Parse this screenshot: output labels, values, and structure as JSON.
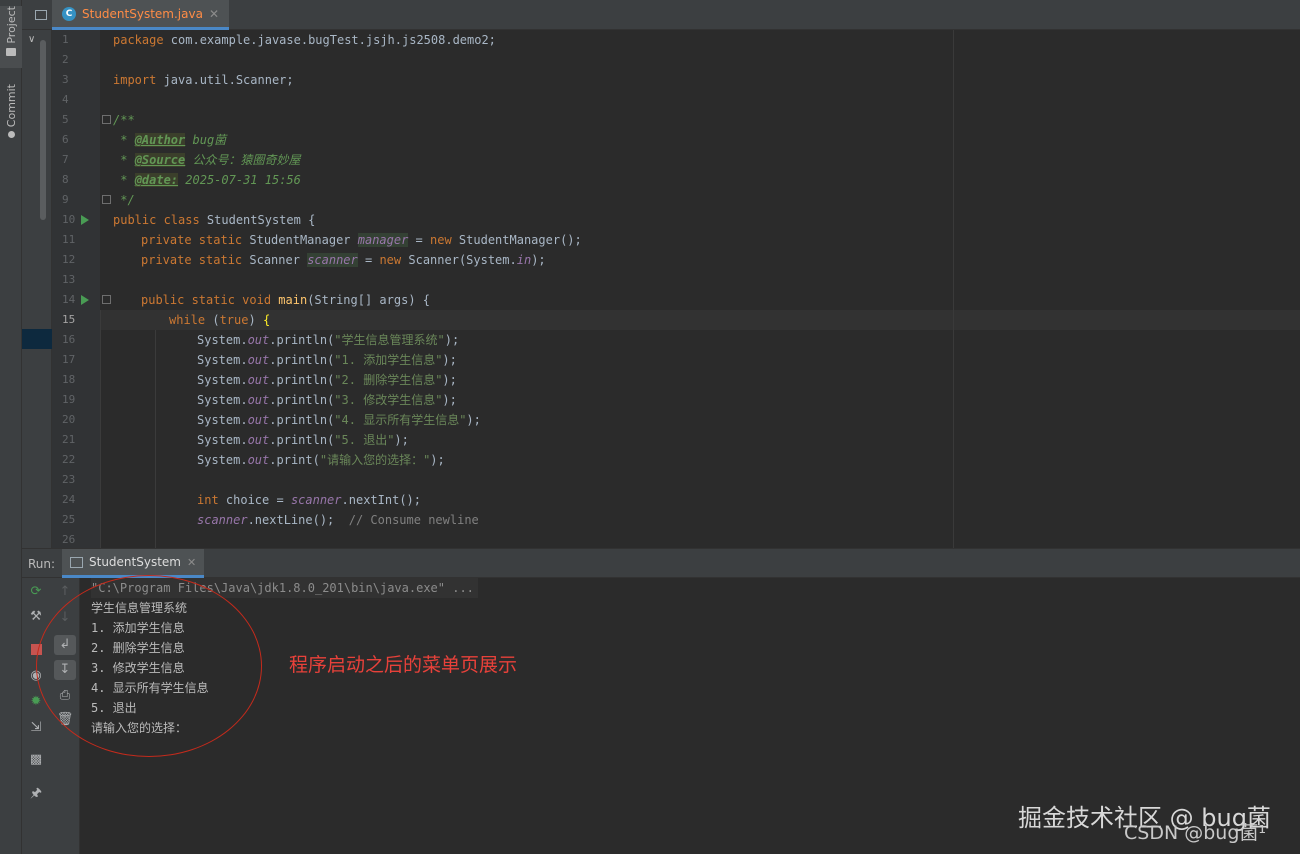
{
  "sidebar": {
    "project_label": "Project",
    "commit_label": "Commit"
  },
  "editor": {
    "tab_label": "StudentSystem.java",
    "tab_icon": "C",
    "current_line": 15,
    "lines": [
      {
        "n": "1"
      },
      {
        "n": "2"
      },
      {
        "n": "3"
      },
      {
        "n": "4"
      },
      {
        "n": "5"
      },
      {
        "n": "6"
      },
      {
        "n": "7"
      },
      {
        "n": "8"
      },
      {
        "n": "9"
      },
      {
        "n": "10"
      },
      {
        "n": "11"
      },
      {
        "n": "12"
      },
      {
        "n": "13"
      },
      {
        "n": "14"
      },
      {
        "n": "15"
      },
      {
        "n": "16"
      },
      {
        "n": "17"
      },
      {
        "n": "18"
      },
      {
        "n": "19"
      },
      {
        "n": "20"
      },
      {
        "n": "21"
      },
      {
        "n": "22"
      },
      {
        "n": "23"
      },
      {
        "n": "24"
      },
      {
        "n": "25"
      },
      {
        "n": "26"
      }
    ],
    "code": {
      "l1_kw": "package",
      "l1_rest": " com.example.javase.bugTest.jsjh.js2508.demo2;",
      "l3_kw": "import",
      "l3_rest": " java.util.Scanner;",
      "l5": "/**",
      "l6_pre": " * ",
      "l6_tag": "@Author",
      "l6_val": " bug菌",
      "l7_pre": " * ",
      "l7_tag": "@Source",
      "l7_val": " 公众号：猿圈奇妙屋",
      "l8_pre": " * ",
      "l8_tag": "@date:",
      "l8_val": " 2025-07-31 15:56",
      "l9": " */",
      "l10_kw": "public class",
      "l10_rest": " StudentSystem {",
      "l11_kw": "private static",
      "l11_type": " StudentManager ",
      "l11_field": "manager",
      "l11_eq": " = ",
      "l11_new": "new",
      "l11_rest": " StudentManager();",
      "l12_kw": "private static",
      "l12_type": " Scanner ",
      "l12_field": "scanner",
      "l12_eq": " = ",
      "l12_new": "new",
      "l12_rest1": " Scanner(System.",
      "l12_in": "in",
      "l12_rest2": ");",
      "l14_kw": "public static void",
      "l14_sp": " ",
      "l14_fn": "main",
      "l14_rest": "(String[] args) {",
      "l15_kw": "while",
      "l15_mid": " (",
      "l15_true": "true",
      "l15_close": ") ",
      "l15_brace": "{",
      "sys": "System.",
      "out": "out",
      "println": ".println(",
      "print": ".print(",
      "close": ");",
      "l16_str": "\"学生信息管理系统\"",
      "l17_str": "\"1. 添加学生信息\"",
      "l18_str": "\"2. 删除学生信息\"",
      "l19_str": "\"3. 修改学生信息\"",
      "l20_str": "\"4. 显示所有学生信息\"",
      "l21_str": "\"5. 退出\"",
      "l22_str": "\"请输入您的选择：\"",
      "l24_kw": "int",
      "l24_mid": " choice = ",
      "l24_field": "scanner",
      "l24_rest": ".nextInt();",
      "l25_field": "scanner",
      "l25_rest": ".nextLine();  ",
      "l25_comment": "// Consume newline"
    }
  },
  "run": {
    "label": "Run:",
    "tab_label": "StudentSystem",
    "console": [
      "\"C:\\Program Files\\Java\\jdk1.8.0_201\\bin\\java.exe\" ...",
      "学生信息管理系统",
      "1. 添加学生信息",
      "2. 删除学生信息",
      "3. 修改学生信息",
      "4. 显示所有学生信息",
      "5. 退出",
      "请输入您的选择："
    ]
  },
  "annotation": {
    "text": "程序启动之后的菜单页展示",
    "color": "#e8413a"
  },
  "watermarks": {
    "juejin": "掘金技术社区 @ bug菌",
    "csdn": "CSDN @bug菌¹"
  },
  "colors": {
    "editor_bg": "#2b2b2b",
    "keyword": "#cc7832",
    "string": "#6a8759",
    "doc_comment": "#629755",
    "field": "#9876aa",
    "function": "#ffc66d",
    "tab_accent": "#4a88c7",
    "run_icon": "#499c54"
  }
}
